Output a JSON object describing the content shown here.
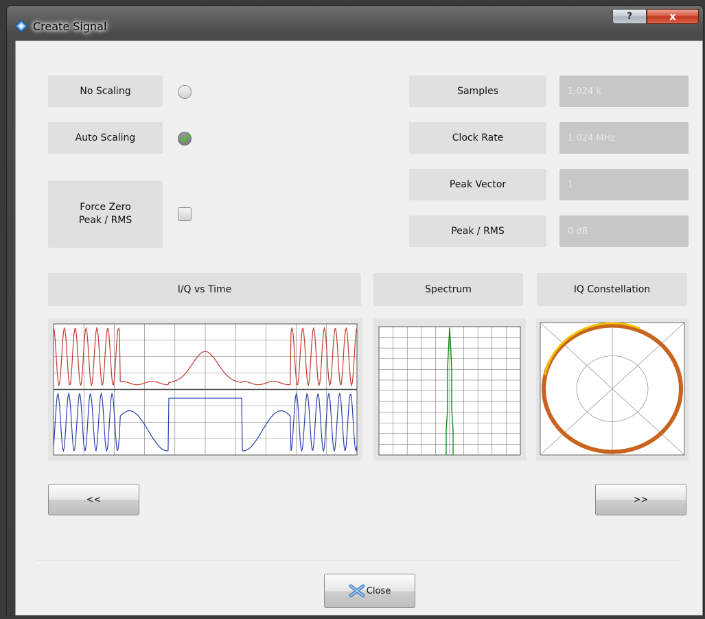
{
  "window": {
    "title": "Create Signal",
    "help_label": "?",
    "close_label": "x"
  },
  "scaling": {
    "no_scaling": {
      "label": "No Scaling",
      "checked": false
    },
    "auto_scaling": {
      "label": "Auto Scaling",
      "checked": true
    },
    "force_zero": {
      "label": "Force Zero\nPeak / RMS",
      "checked": false
    }
  },
  "info": {
    "samples": {
      "label": "Samples",
      "value": "1.024 k"
    },
    "clock_rate": {
      "label": "Clock Rate",
      "value": "1.024 MHz"
    },
    "peak_vector": {
      "label": "Peak Vector",
      "value": "1"
    },
    "peak_rms": {
      "label": "Peak / RMS",
      "value": "0  dB"
    }
  },
  "plots": {
    "iq_time": {
      "title": "I/Q vs Time"
    },
    "spectrum": {
      "title": "Spectrum"
    },
    "constellation": {
      "title": "IQ Constellation"
    }
  },
  "nav": {
    "prev_label": "<<",
    "next_label": ">>"
  },
  "footer": {
    "close_label": "Close"
  },
  "colors": {
    "i_trace": "#c0392b",
    "q_trace": "#2b3fb0",
    "spectrum_trace": "#1a8a1a",
    "constellation_outer": "#c8641e",
    "constellation_inner": "#f2c200"
  }
}
